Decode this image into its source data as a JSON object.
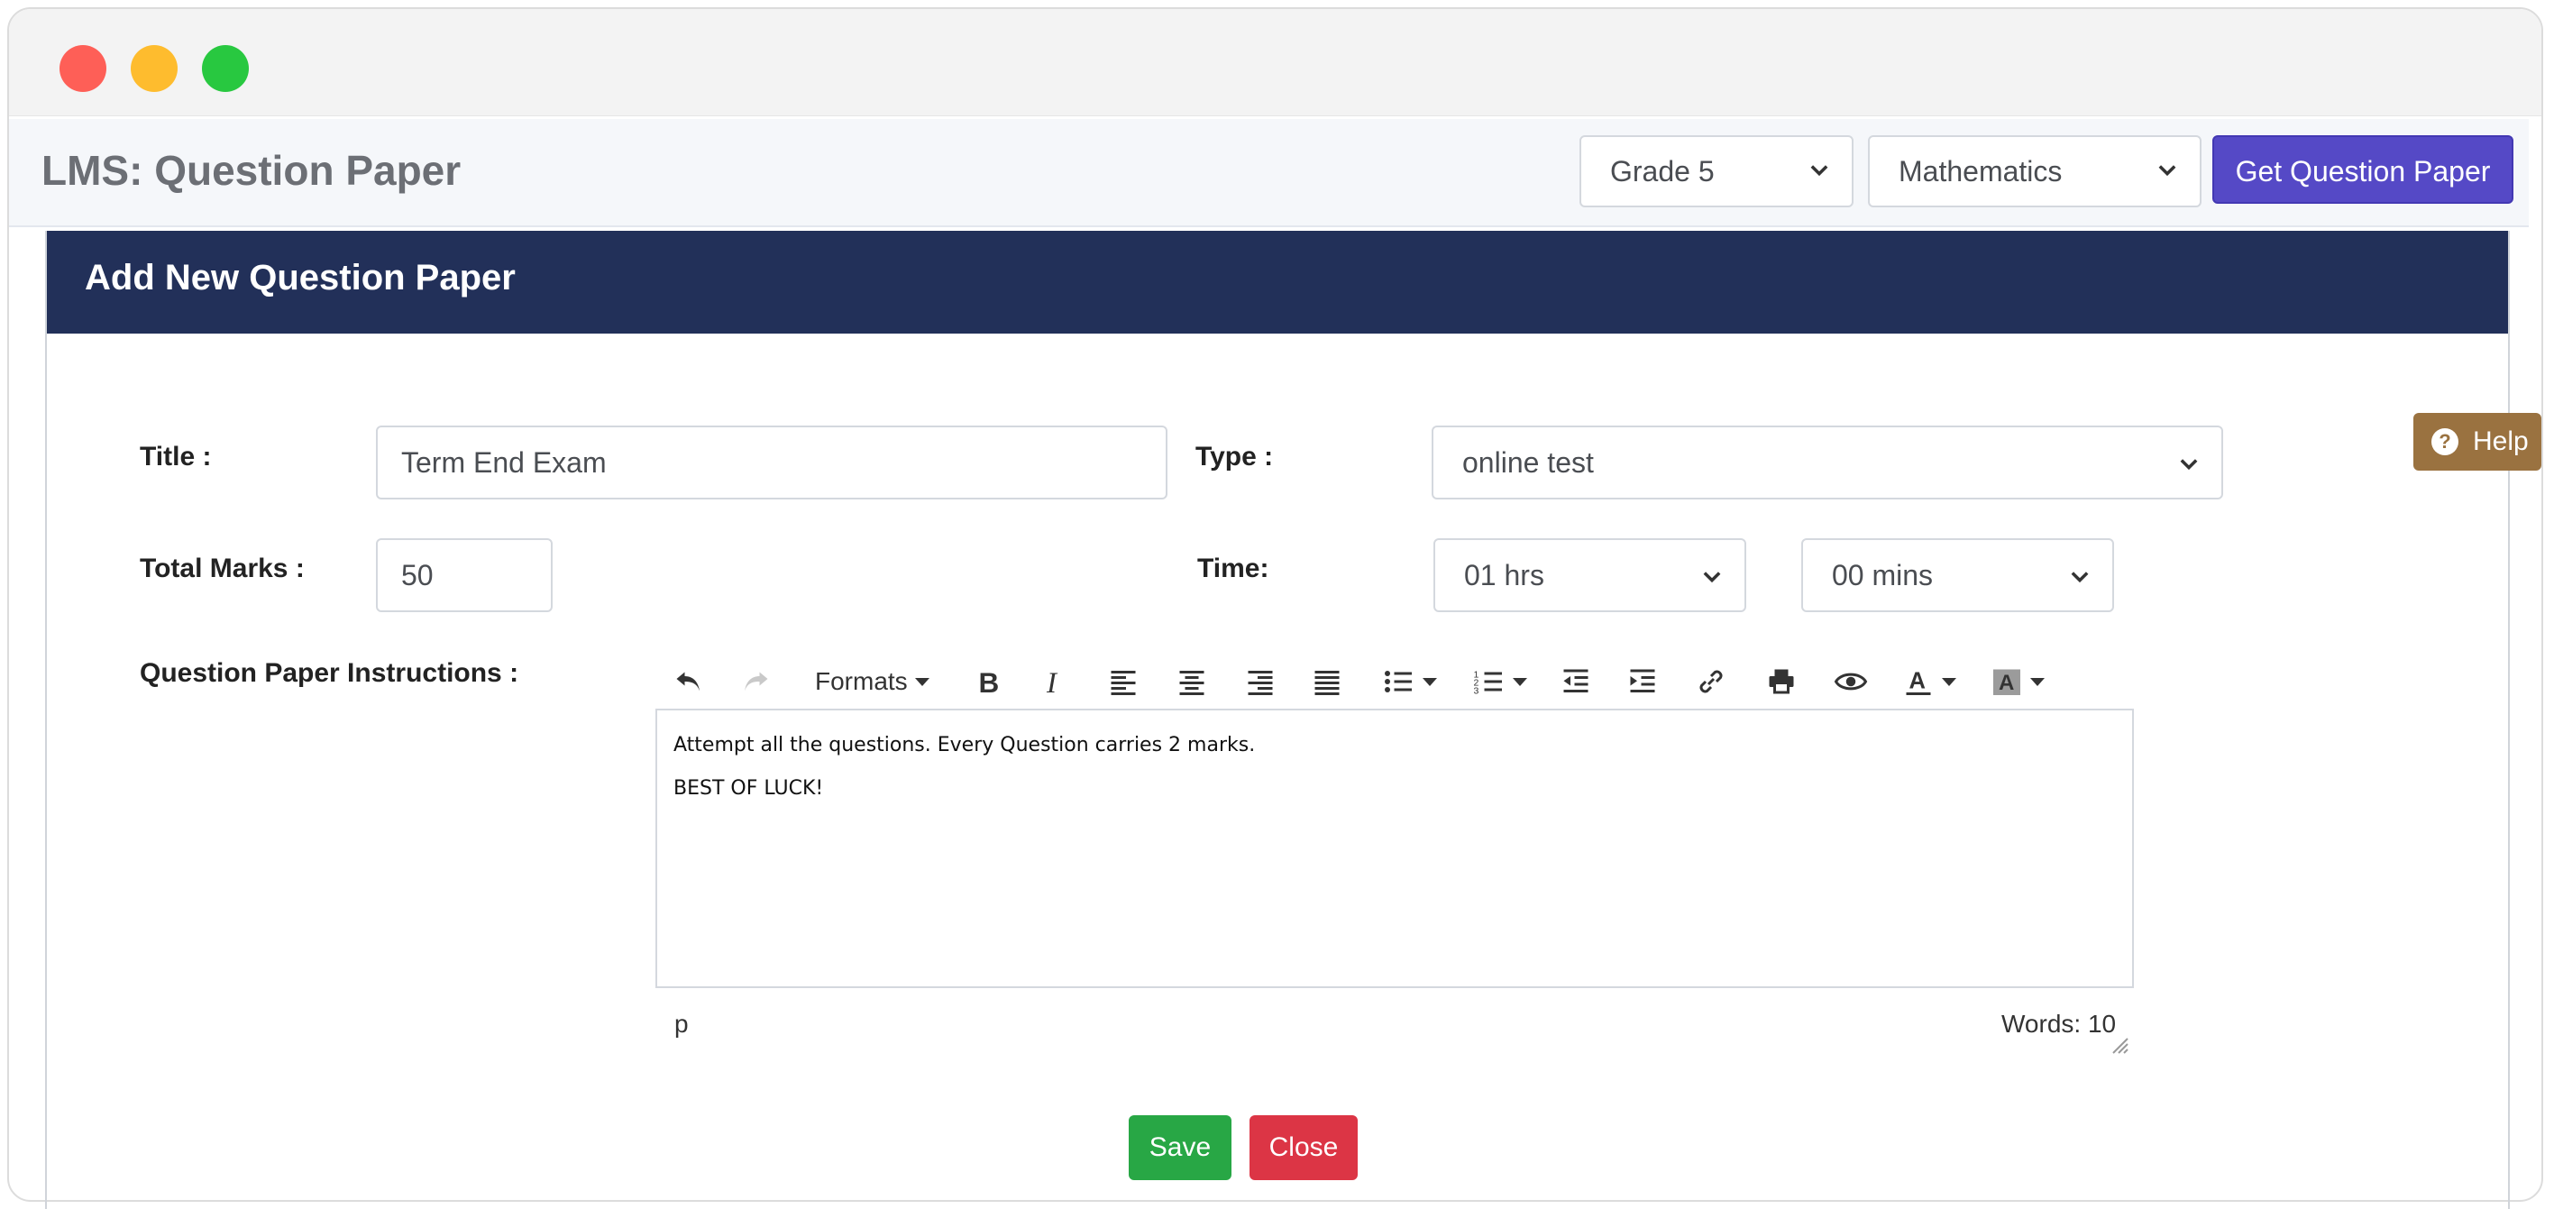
{
  "header": {
    "title": "LMS:  Question Paper",
    "grade_select": "Grade 5",
    "subject_select": "Mathematics",
    "get_button": "Get Question Paper"
  },
  "panel": {
    "title": "Add New Question Paper"
  },
  "form": {
    "title_label": "Title :",
    "title_value": "Term End Exam",
    "type_label": "Type :",
    "type_value": "online test",
    "total_marks_label": "Total Marks :",
    "total_marks_value": "50",
    "time_label": "Time:",
    "hours_value": "01 hrs",
    "mins_value": "00 mins",
    "instructions_label": "Question Paper Instructions :"
  },
  "editor": {
    "formats_label": "Formats",
    "lines": [
      "Attempt all the questions. Every Question carries 2 marks.",
      "BEST OF LUCK!"
    ],
    "status_path": "p",
    "word_count": "Words: 10"
  },
  "help": {
    "label": "Help"
  },
  "actions": {
    "save": "Save",
    "close": "Close"
  },
  "colors": {
    "header_bg": "#223059",
    "primary_button": "#5549c6",
    "save_button": "#28a745",
    "close_button": "#dc3545",
    "help_button": "#9a7240"
  },
  "icons": [
    "undo-icon",
    "redo-icon",
    "bold-icon",
    "italic-icon",
    "align-left-icon",
    "align-center-icon",
    "align-right-icon",
    "align-justify-icon",
    "bullet-list-icon",
    "numbered-list-icon",
    "outdent-icon",
    "indent-icon",
    "link-icon",
    "print-icon",
    "preview-icon",
    "text-color-icon",
    "background-color-icon",
    "chevron-down-icon",
    "question-circle-icon"
  ]
}
